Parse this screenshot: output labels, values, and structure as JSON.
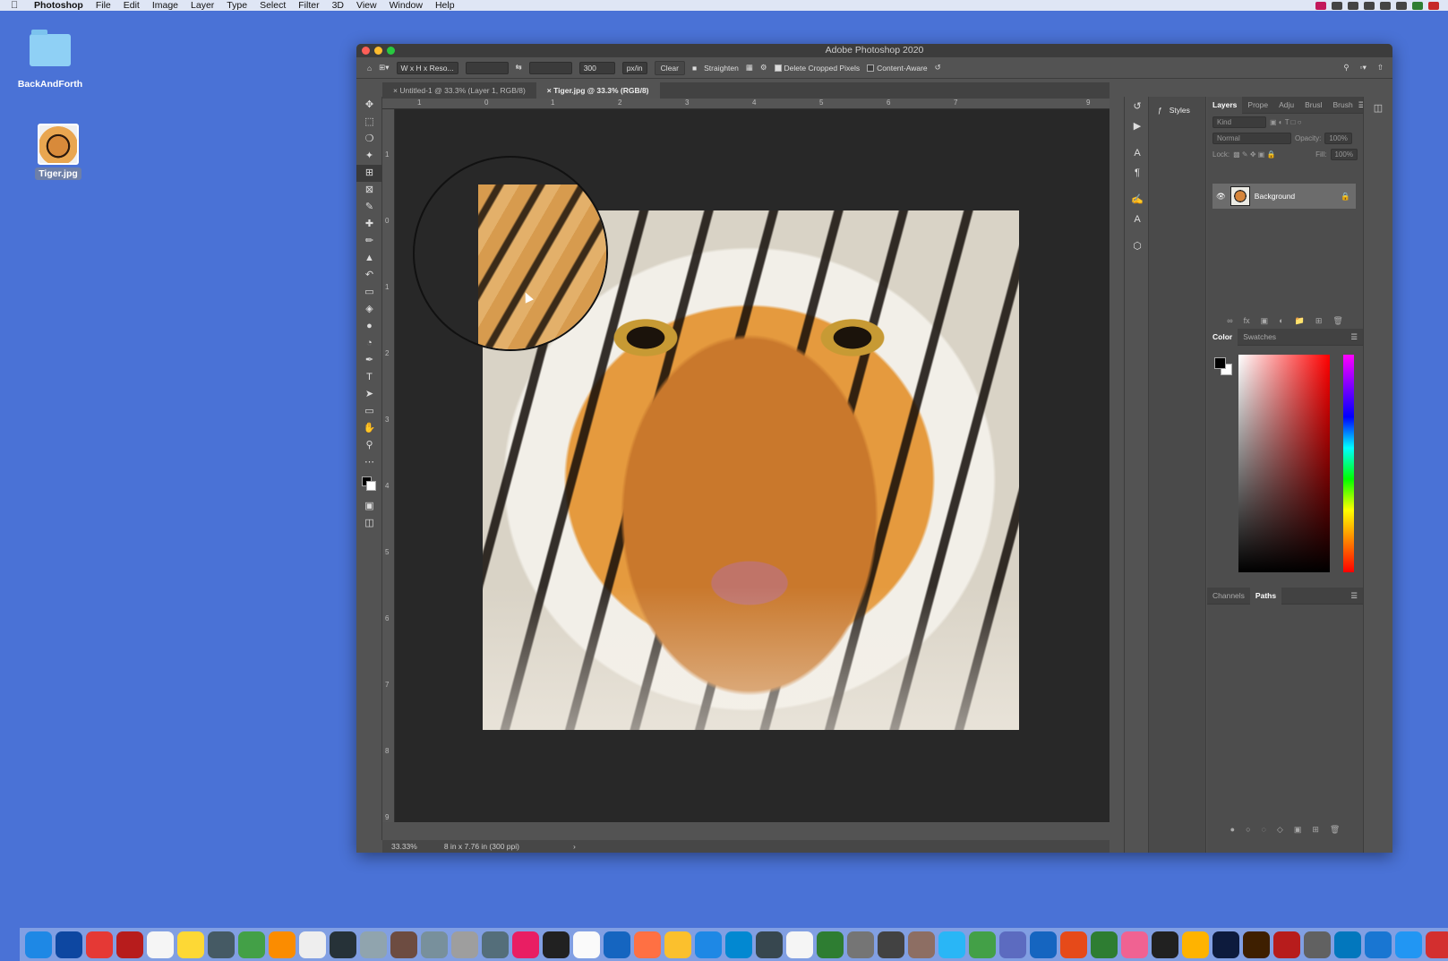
{
  "menubar": {
    "app_name": "Photoshop",
    "items": [
      "File",
      "Edit",
      "Image",
      "Layer",
      "Type",
      "Select",
      "Filter",
      "3D",
      "View",
      "Window",
      "Help"
    ]
  },
  "desktop": {
    "folder_label": "BackAndForth",
    "file_label": "Tiger.jpg"
  },
  "window": {
    "title": "Adobe Photoshop 2020"
  },
  "options_bar": {
    "ratio_select": "W x H x Reso...",
    "resolution_value": "300",
    "units_select": "px/in",
    "clear_label": "Clear",
    "straighten_label": "Straighten",
    "delete_cropped_label": "Delete Cropped Pixels",
    "delete_cropped_checked": true,
    "content_aware_label": "Content-Aware",
    "content_aware_checked": false
  },
  "doc_tabs": [
    {
      "label": "Untitled-1 @ 33.3% (Layer 1, RGB/8)",
      "active": false
    },
    {
      "label": "Tiger.jpg @ 33.3% (RGB/8)",
      "active": true
    }
  ],
  "rulers": {
    "top": [
      "1",
      "0",
      "1",
      "2",
      "3",
      "4",
      "5",
      "6",
      "7",
      "9"
    ],
    "left": [
      "1",
      "0",
      "1",
      "2",
      "3",
      "4",
      "5",
      "6",
      "7",
      "8",
      "9"
    ]
  },
  "status": {
    "zoom": "33.33%",
    "doc_info": "8 in x 7.76 in (300 ppi)"
  },
  "styles_panel": {
    "label": "Styles"
  },
  "layers_panel": {
    "tabs": [
      "Layers",
      "Prope",
      "Adju",
      "Brusl",
      "Brush"
    ],
    "kind_placeholder": "Kind",
    "blend_mode": "Normal",
    "opacity_label": "Opacity:",
    "opacity_value": "100%",
    "lock_label": "Lock:",
    "fill_label": "Fill:",
    "fill_value": "100%",
    "layer_name": "Background"
  },
  "color_panel": {
    "tabs": [
      "Color",
      "Swatches"
    ],
    "foreground": "#000000",
    "background": "#ffffff"
  },
  "paths_panel": {
    "tabs": [
      "Channels",
      "Paths"
    ]
  },
  "dock_apps": [
    "Finder",
    "App Store",
    "Mail",
    "Dictionary",
    "Calendar 28",
    "Notes",
    "Notebook",
    "Chrome",
    "Photos",
    "TextEdit",
    "Sketch",
    "Preview",
    "Notes",
    "Automator",
    "Script",
    "Font",
    "Music",
    "S",
    "Pages",
    "Help",
    "Firefox",
    "Keynote",
    "Keynote",
    "Safari",
    "Kindle",
    "TextEdit",
    "Numbers",
    "Finder",
    "Folder",
    "Files",
    "Kindle",
    "Earth",
    "Settings",
    "Word",
    "PowerPoint",
    "Excel",
    "Books",
    "App",
    "Toolbox",
    "Ps",
    "Ai",
    "Acrobat",
    "Preferences",
    "QuickTime",
    "Downloads",
    "Zoom",
    "Q"
  ]
}
